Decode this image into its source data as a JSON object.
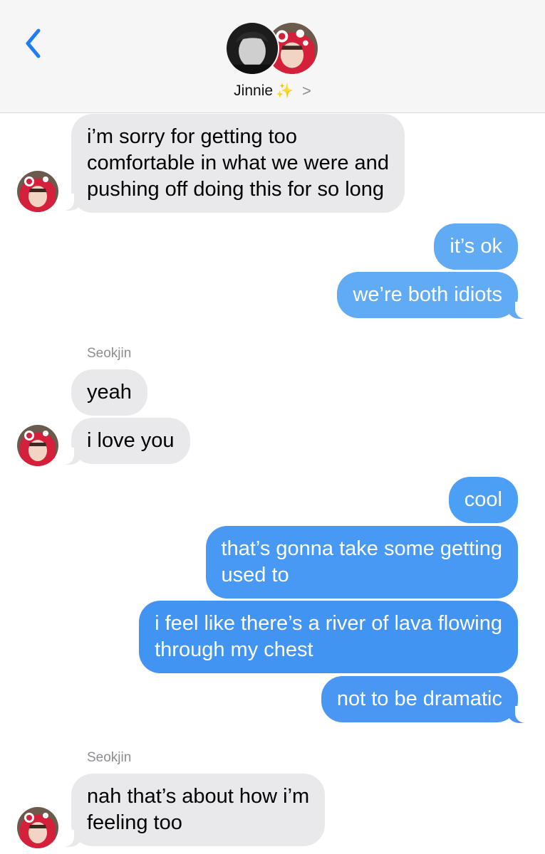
{
  "header": {
    "contact_name": "Jinnie",
    "sparkle_icon": "sparkles",
    "chevron": ">"
  },
  "messages": [
    {
      "side": "in",
      "text": "i’m sorry for getting too\ncomfortable in what we were and\npushing off doing this for so long"
    },
    {
      "side": "out",
      "text": "it’s ok"
    },
    {
      "side": "out",
      "text": "we’re both idiots"
    },
    {
      "side": "in",
      "sender": "Seokjin",
      "text": "yeah"
    },
    {
      "side": "in",
      "text": "i love you"
    },
    {
      "side": "out",
      "text": "cool"
    },
    {
      "side": "out",
      "text": "that’s gonna take some getting\nused to"
    },
    {
      "side": "out",
      "text": "i feel like there’s a river of lava flowing\nthrough my chest"
    },
    {
      "side": "out",
      "text": "not to be dramatic"
    },
    {
      "side": "in",
      "sender": "Seokjin",
      "text": "nah that’s about how i’m\nfeeling too"
    }
  ],
  "colors": {
    "incoming_bubble": "#e9e9eb",
    "outgoing_bubble": "#3d94f6",
    "accent": "#1f7ef6"
  }
}
